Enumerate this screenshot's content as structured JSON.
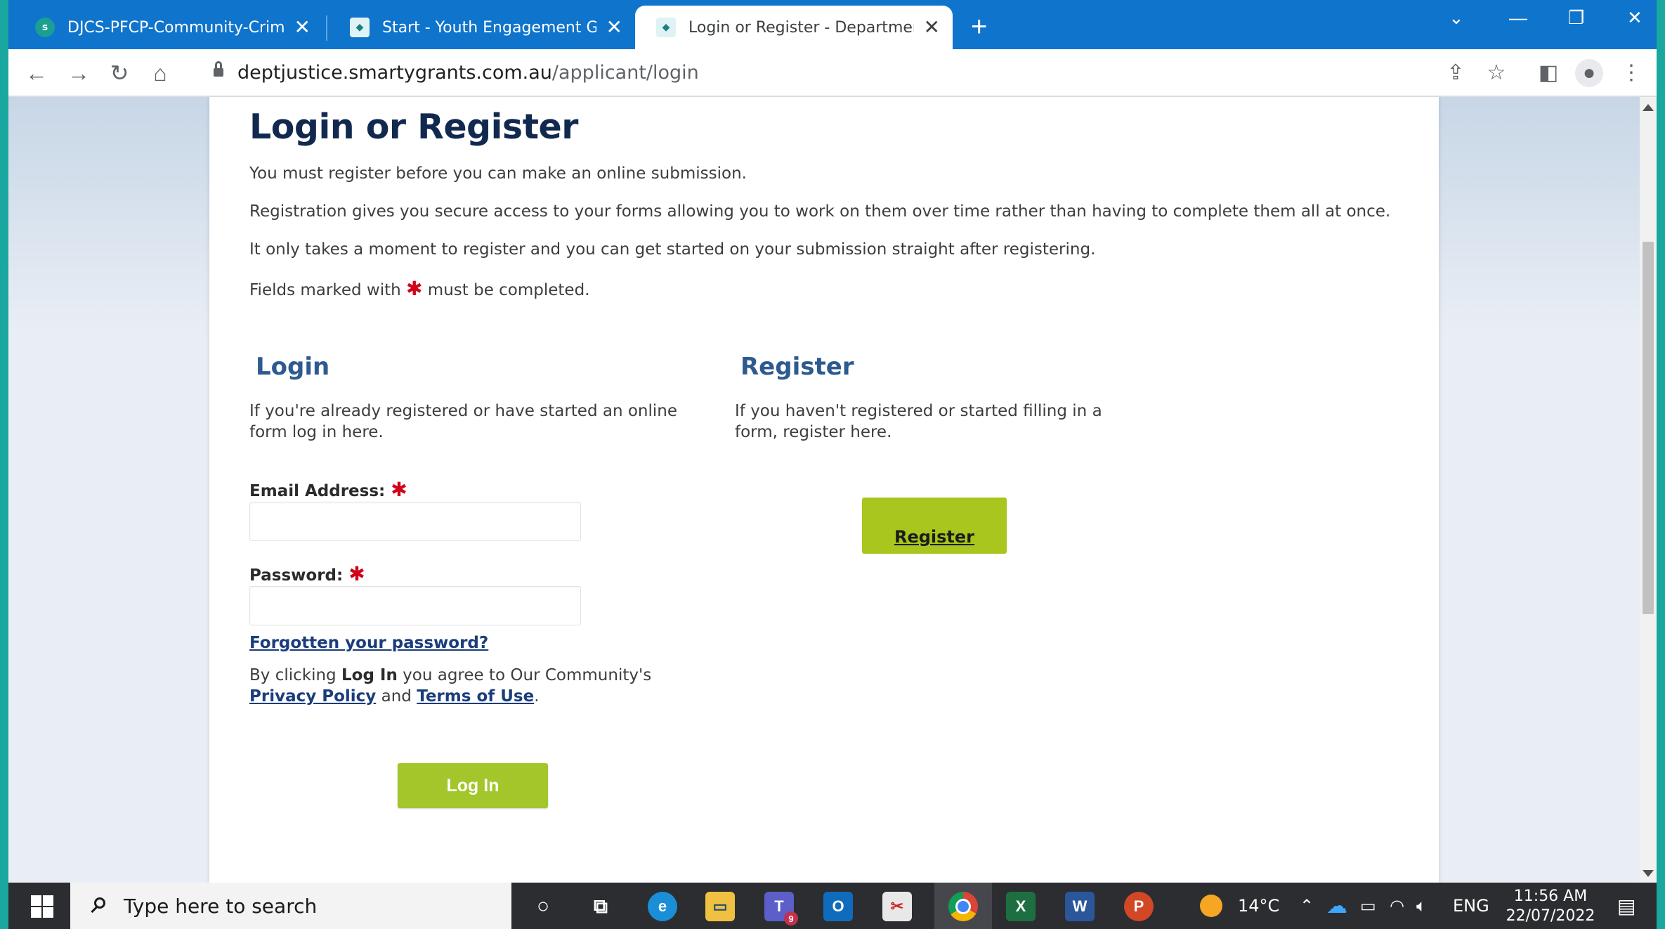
{
  "browser": {
    "tabs": [
      {
        "title": "DJCS-PFCP-Community-Crime-Pr",
        "favicon": "sharepoint-icon"
      },
      {
        "title": "Start - Youth Engagement Grants",
        "favicon": "smartygrants-icon"
      },
      {
        "title": "Login or Register - Department o",
        "favicon": "smartygrants-icon"
      }
    ],
    "url_host": "deptjustice.smartygrants.com.au",
    "url_path": "/applicant/login"
  },
  "page": {
    "title": "Login or Register",
    "intro": [
      "You must register before you can make an online submission.",
      "Registration gives you secure access to your forms allowing you to work on them over time rather than having to complete them all at once.",
      "It only takes a moment to register and you can get started on your submission straight after registering."
    ],
    "fields_note_prefix": "Fields marked with",
    "fields_note_suffix": "must be completed.",
    "required_mark": "✱",
    "login": {
      "heading": "Login",
      "description": "If you're already registered or have started an online form log in here.",
      "email_label": "Email Address:",
      "email_value": "",
      "password_label": "Password:",
      "password_value": "",
      "forgot_link": "Forgotten your password?",
      "agree_prefix": "By clicking",
      "agree_action": "Log In",
      "agree_middle": "you agree to Our Community's",
      "privacy_link": "Privacy Policy",
      "and_text": "and",
      "terms_link": "Terms of Use",
      "period": ".",
      "button_label": "Log In"
    },
    "register": {
      "heading": "Register",
      "description": "If you haven't registered or started filling in a form, register here.",
      "button_label": "Register"
    }
  },
  "taskbar": {
    "search_placeholder": "Type here to search",
    "teams_badge": "9",
    "temperature": "14°C",
    "language": "ENG",
    "time": "11:56 AM",
    "date": "22/07/2022"
  },
  "colors": {
    "tabbar": "#0f74cc",
    "heading": "#12294f",
    "section_heading": "#2d5a8f",
    "link": "#1a3d7c",
    "button_green": "#a3c62a",
    "required": "#d0021b"
  }
}
